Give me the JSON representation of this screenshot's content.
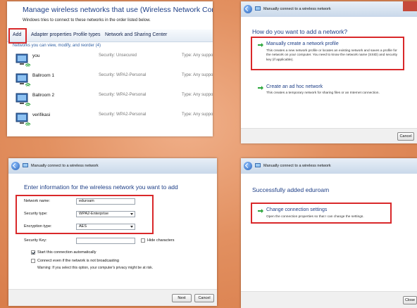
{
  "manage": {
    "title": "Manage wireless networks that use (Wireless Network Connection)",
    "subtitle": "Windows tries to connect to these networks in the order listed below.",
    "toolbar": {
      "add": "Add",
      "adapter": "Adapter properties",
      "profile_types": "Profile types",
      "sharing": "Network and Sharing Center"
    },
    "list_header": "Networks you can view, modify, and reorder (4)",
    "networks": [
      {
        "name": "you",
        "security": "Security: Unsecured",
        "type": "Type: Any support"
      },
      {
        "name": "Ballroom 1",
        "security": "Security: WPA2-Personal",
        "type": "Type: Any support"
      },
      {
        "name": "Ballroom 2",
        "security": "Security: WPA2-Personal",
        "type": "Type: Any support"
      },
      {
        "name": "verifikasi",
        "security": "Security: WPA2-Personal",
        "type": "Type: Any support"
      }
    ]
  },
  "how_add": {
    "caption": "Manually connect to a wireless network",
    "heading": "How do you want to add a network?",
    "option1_title": "Manually create a network profile",
    "option1_desc": "This creates a new network profile or locates an existing network and saves a profile for the network on your computer. You need to know the network name (SSID) and security key (if applicable).",
    "option2_title": "Create an ad hoc network",
    "option2_desc": "This creates a temporary network for sharing files or an Internet connection.",
    "cancel": "Cancel"
  },
  "enter_info": {
    "caption": "Manually connect to a wireless network",
    "heading": "Enter information for the wireless network you want to add",
    "network_name_label": "Network name:",
    "network_name_value": "eduroam",
    "security_type_label": "Security type:",
    "security_type_value": "WPA2-Enterprise",
    "encryption_type_label": "Encryption type:",
    "encryption_type_value": "AES",
    "security_key_label": "Security Key:",
    "security_key_value": "",
    "hide_characters": "Hide characters",
    "start_auto": "Start this connection automatically",
    "connect_even": "Connect even if the network is not broadcasting",
    "warning": "Warning: If you select this option, your computer's privacy might be at risk.",
    "next": "Next",
    "cancel": "Cancel"
  },
  "success": {
    "caption": "Manually connect to a wireless network",
    "heading": "Successfully added eduroam",
    "option_title": "Change connection settings",
    "option_desc": "Open the connection properties so that I can change the settings.",
    "close": "Close"
  },
  "colors": {
    "accent_red": "#d9282a",
    "title_blue": "#1e3f87",
    "option_arrow_green": "#2aa63b"
  }
}
